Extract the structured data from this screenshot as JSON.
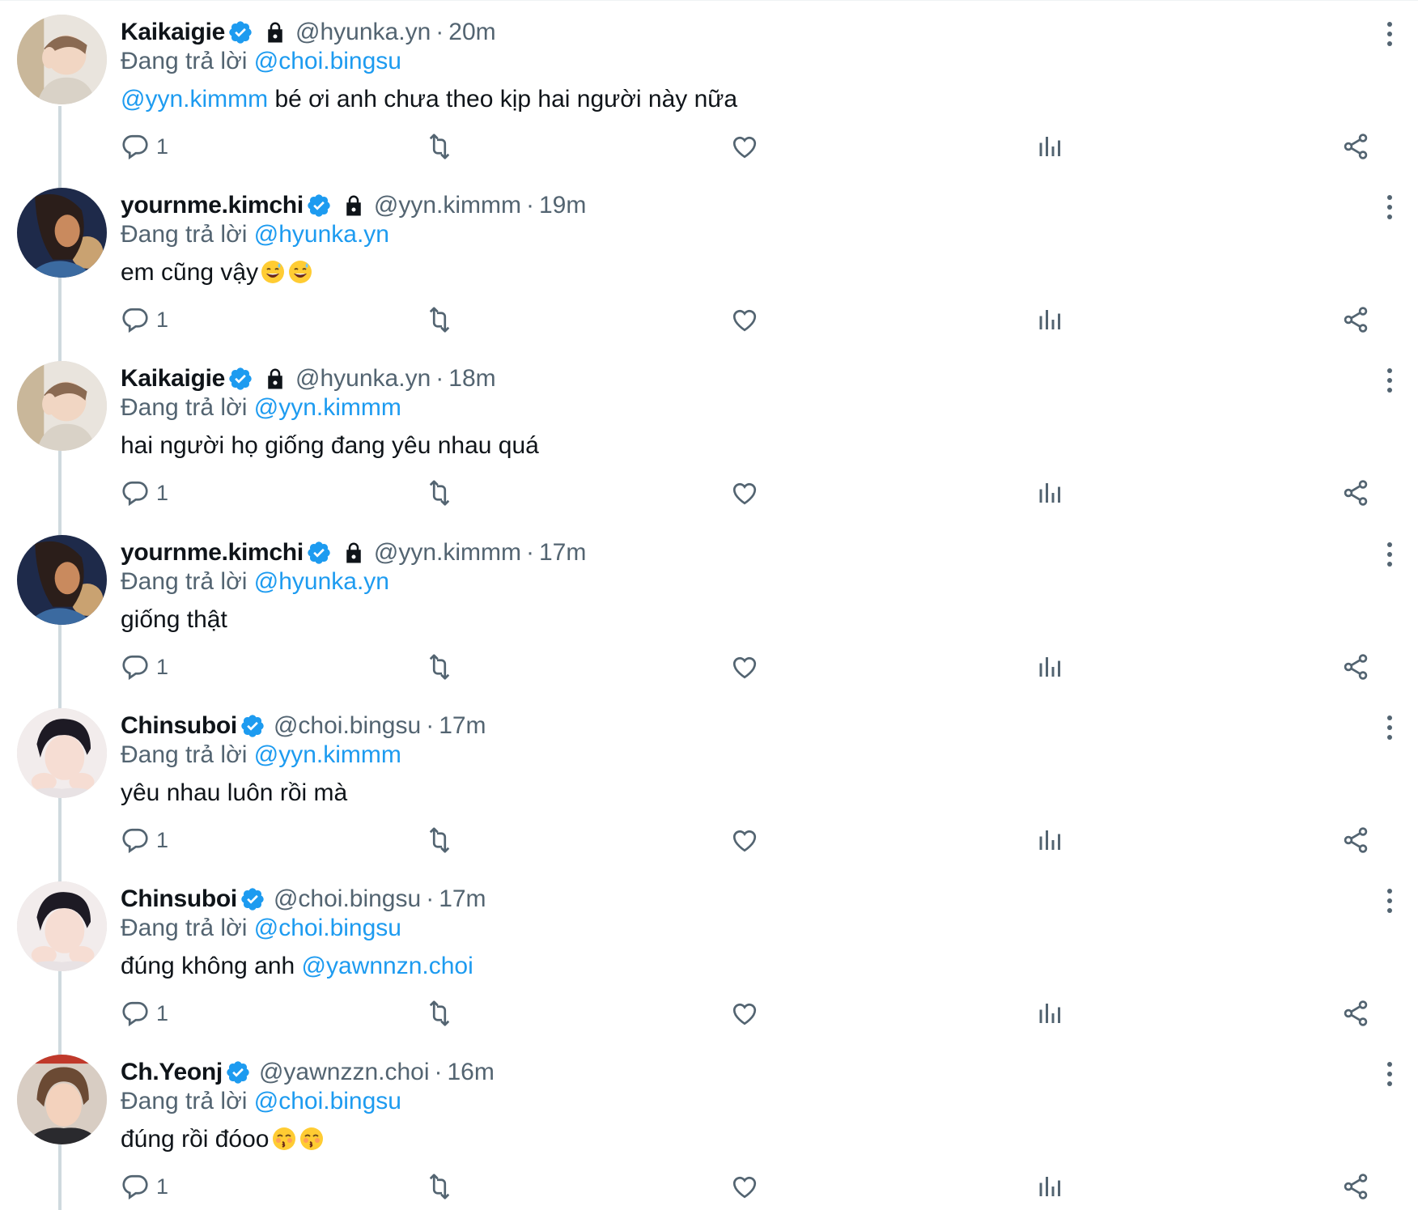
{
  "replying_prefix": "Đang trả lời",
  "colors": {
    "accent": "#1d9bf0",
    "muted": "#536471",
    "text": "#0f1419",
    "thread_line": "#cfd9de"
  },
  "tweets": [
    {
      "name": "Kaikaigie",
      "verified": true,
      "locked": true,
      "handle": "@hyunka.yn",
      "sep": "·",
      "time": "20m",
      "replying_to": "@choi.bingsu",
      "mention": "@yyn.kimmm",
      "text": "bé ơi anh chưa theo kịp hai người này nữa",
      "reply_count": "1",
      "avatar_icon": "avatar-kaikaigie"
    },
    {
      "name": "yournme.kimchi",
      "verified": true,
      "locked": true,
      "handle": "@yyn.kimmm",
      "sep": "·",
      "time": "19m",
      "replying_to": "@hyunka.yn",
      "text": "em cũng vậy",
      "emoji": "sweat-smile-emoji",
      "reply_count": "1",
      "avatar_icon": "avatar-yournme"
    },
    {
      "name": "Kaikaigie",
      "verified": true,
      "locked": true,
      "handle": "@hyunka.yn",
      "sep": "·",
      "time": "18m",
      "replying_to": "@yyn.kimmm",
      "text": "hai người họ giống đang yêu nhau quá",
      "reply_count": "1",
      "avatar_icon": "avatar-kaikaigie"
    },
    {
      "name": "yournme.kimchi",
      "verified": true,
      "locked": true,
      "handle": "@yyn.kimmm",
      "sep": "·",
      "time": "17m",
      "replying_to": "@hyunka.yn",
      "text": "giống thật",
      "reply_count": "1",
      "avatar_icon": "avatar-yournme"
    },
    {
      "name": "Chinsuboi",
      "verified": true,
      "locked": false,
      "handle": "@choi.bingsu",
      "sep": "·",
      "time": "17m",
      "replying_to": "@yyn.kimmm",
      "text": "yêu nhau luôn rồi mà",
      "reply_count": "1",
      "avatar_icon": "avatar-chinsuboi"
    },
    {
      "name": "Chinsuboi",
      "verified": true,
      "locked": false,
      "handle": "@choi.bingsu",
      "sep": "·",
      "time": "17m",
      "replying_to": "@choi.bingsu",
      "text": "đúng không anh",
      "mention_after": "@yawnnzn.choi",
      "reply_count": "1",
      "avatar_icon": "avatar-chinsuboi"
    },
    {
      "name": "Ch.Yeonj",
      "verified": true,
      "locked": false,
      "handle": "@yawnzzn.choi",
      "sep": "·",
      "time": "16m",
      "replying_to": "@choi.bingsu",
      "text": "đúng rồi đóoo",
      "emoji": "kissing-emoji",
      "reply_count": "1",
      "avatar_icon": "avatar-chyeonj"
    }
  ]
}
